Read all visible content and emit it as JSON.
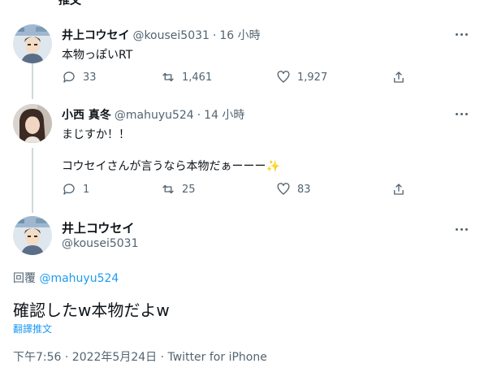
{
  "clipped_header": "推文",
  "tweets": [
    {
      "name": "井上コウセイ",
      "handle": "@kousei5031",
      "sep": "·",
      "time": "16 小時",
      "text": "本物っぽいRT",
      "replies": "33",
      "retweets": "1,461",
      "likes": "1,927"
    },
    {
      "name": "小西 真冬",
      "handle": "@mahuyu524",
      "sep": "·",
      "time": "14 小時",
      "text_line1": "まじすか！！",
      "text_line2": "コウセイさんが言うなら本物だぁーーー✨",
      "replies": "1",
      "retweets": "25",
      "likes": "83"
    }
  ],
  "focused": {
    "name": "井上コウセイ",
    "handle": "@kousei5031",
    "reply_prefix": "回覆 ",
    "reply_to": "@mahuyu524",
    "text": "確認したw本物だよw",
    "translate": "翻譯推文",
    "time": "下午7:56 · 2022年5月24日",
    "sep": " · ",
    "source": "Twitter for iPhone"
  },
  "icons": {
    "reply": "reply-icon",
    "retweet": "retweet-icon",
    "like": "heart-icon",
    "share": "share-icon",
    "more": "more-icon"
  },
  "colors": {
    "text": "#0f1419",
    "muted": "#536471",
    "link": "#1d9bf0",
    "line": "#cfd9de"
  }
}
